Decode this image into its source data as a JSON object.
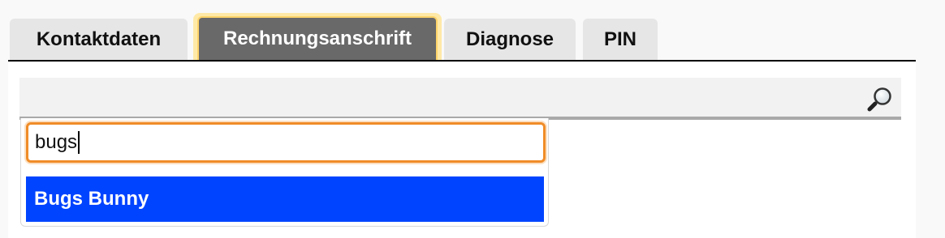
{
  "tabs": [
    {
      "label": "Kontaktdaten",
      "active": false
    },
    {
      "label": "Rechnungsanschrift",
      "active": true
    },
    {
      "label": "Diagnose",
      "active": false
    },
    {
      "label": "PIN",
      "active": false
    }
  ],
  "search": {
    "icon": "magnifier-icon",
    "query": "bugs"
  },
  "results": [
    {
      "label": "Bugs Bunny",
      "highlighted": true
    }
  ],
  "colors": {
    "active_tab_bg": "#696969",
    "focus_outline": "#f08c28",
    "highlight": "#0044ff"
  }
}
